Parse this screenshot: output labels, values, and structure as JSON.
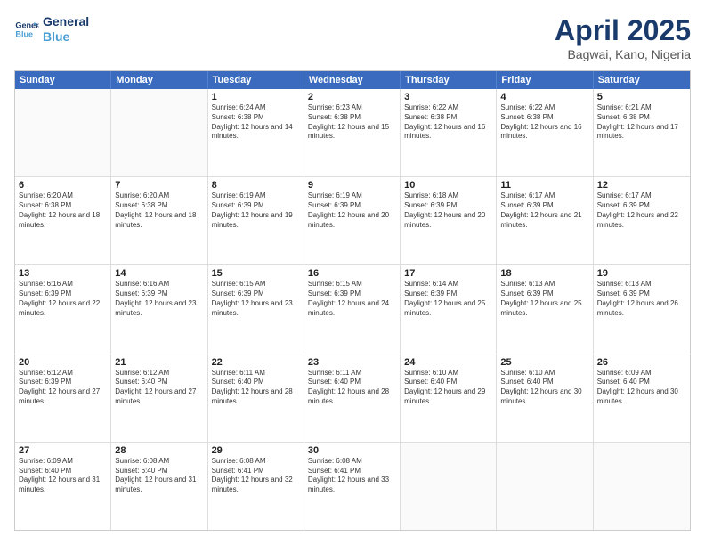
{
  "logo": {
    "line1": "General",
    "line2": "Blue"
  },
  "title": "April 2025",
  "subtitle": "Bagwai, Kano, Nigeria",
  "weekdays": [
    "Sunday",
    "Monday",
    "Tuesday",
    "Wednesday",
    "Thursday",
    "Friday",
    "Saturday"
  ],
  "weeks": [
    [
      {
        "day": "",
        "sunrise": "",
        "sunset": "",
        "daylight": ""
      },
      {
        "day": "",
        "sunrise": "",
        "sunset": "",
        "daylight": ""
      },
      {
        "day": "1",
        "sunrise": "Sunrise: 6:24 AM",
        "sunset": "Sunset: 6:38 PM",
        "daylight": "Daylight: 12 hours and 14 minutes."
      },
      {
        "day": "2",
        "sunrise": "Sunrise: 6:23 AM",
        "sunset": "Sunset: 6:38 PM",
        "daylight": "Daylight: 12 hours and 15 minutes."
      },
      {
        "day": "3",
        "sunrise": "Sunrise: 6:22 AM",
        "sunset": "Sunset: 6:38 PM",
        "daylight": "Daylight: 12 hours and 16 minutes."
      },
      {
        "day": "4",
        "sunrise": "Sunrise: 6:22 AM",
        "sunset": "Sunset: 6:38 PM",
        "daylight": "Daylight: 12 hours and 16 minutes."
      },
      {
        "day": "5",
        "sunrise": "Sunrise: 6:21 AM",
        "sunset": "Sunset: 6:38 PM",
        "daylight": "Daylight: 12 hours and 17 minutes."
      }
    ],
    [
      {
        "day": "6",
        "sunrise": "Sunrise: 6:20 AM",
        "sunset": "Sunset: 6:38 PM",
        "daylight": "Daylight: 12 hours and 18 minutes."
      },
      {
        "day": "7",
        "sunrise": "Sunrise: 6:20 AM",
        "sunset": "Sunset: 6:38 PM",
        "daylight": "Daylight: 12 hours and 18 minutes."
      },
      {
        "day": "8",
        "sunrise": "Sunrise: 6:19 AM",
        "sunset": "Sunset: 6:39 PM",
        "daylight": "Daylight: 12 hours and 19 minutes."
      },
      {
        "day": "9",
        "sunrise": "Sunrise: 6:19 AM",
        "sunset": "Sunset: 6:39 PM",
        "daylight": "Daylight: 12 hours and 20 minutes."
      },
      {
        "day": "10",
        "sunrise": "Sunrise: 6:18 AM",
        "sunset": "Sunset: 6:39 PM",
        "daylight": "Daylight: 12 hours and 20 minutes."
      },
      {
        "day": "11",
        "sunrise": "Sunrise: 6:17 AM",
        "sunset": "Sunset: 6:39 PM",
        "daylight": "Daylight: 12 hours and 21 minutes."
      },
      {
        "day": "12",
        "sunrise": "Sunrise: 6:17 AM",
        "sunset": "Sunset: 6:39 PM",
        "daylight": "Daylight: 12 hours and 22 minutes."
      }
    ],
    [
      {
        "day": "13",
        "sunrise": "Sunrise: 6:16 AM",
        "sunset": "Sunset: 6:39 PM",
        "daylight": "Daylight: 12 hours and 22 minutes."
      },
      {
        "day": "14",
        "sunrise": "Sunrise: 6:16 AM",
        "sunset": "Sunset: 6:39 PM",
        "daylight": "Daylight: 12 hours and 23 minutes."
      },
      {
        "day": "15",
        "sunrise": "Sunrise: 6:15 AM",
        "sunset": "Sunset: 6:39 PM",
        "daylight": "Daylight: 12 hours and 23 minutes."
      },
      {
        "day": "16",
        "sunrise": "Sunrise: 6:15 AM",
        "sunset": "Sunset: 6:39 PM",
        "daylight": "Daylight: 12 hours and 24 minutes."
      },
      {
        "day": "17",
        "sunrise": "Sunrise: 6:14 AM",
        "sunset": "Sunset: 6:39 PM",
        "daylight": "Daylight: 12 hours and 25 minutes."
      },
      {
        "day": "18",
        "sunrise": "Sunrise: 6:13 AM",
        "sunset": "Sunset: 6:39 PM",
        "daylight": "Daylight: 12 hours and 25 minutes."
      },
      {
        "day": "19",
        "sunrise": "Sunrise: 6:13 AM",
        "sunset": "Sunset: 6:39 PM",
        "daylight": "Daylight: 12 hours and 26 minutes."
      }
    ],
    [
      {
        "day": "20",
        "sunrise": "Sunrise: 6:12 AM",
        "sunset": "Sunset: 6:39 PM",
        "daylight": "Daylight: 12 hours and 27 minutes."
      },
      {
        "day": "21",
        "sunrise": "Sunrise: 6:12 AM",
        "sunset": "Sunset: 6:40 PM",
        "daylight": "Daylight: 12 hours and 27 minutes."
      },
      {
        "day": "22",
        "sunrise": "Sunrise: 6:11 AM",
        "sunset": "Sunset: 6:40 PM",
        "daylight": "Daylight: 12 hours and 28 minutes."
      },
      {
        "day": "23",
        "sunrise": "Sunrise: 6:11 AM",
        "sunset": "Sunset: 6:40 PM",
        "daylight": "Daylight: 12 hours and 28 minutes."
      },
      {
        "day": "24",
        "sunrise": "Sunrise: 6:10 AM",
        "sunset": "Sunset: 6:40 PM",
        "daylight": "Daylight: 12 hours and 29 minutes."
      },
      {
        "day": "25",
        "sunrise": "Sunrise: 6:10 AM",
        "sunset": "Sunset: 6:40 PM",
        "daylight": "Daylight: 12 hours and 30 minutes."
      },
      {
        "day": "26",
        "sunrise": "Sunrise: 6:09 AM",
        "sunset": "Sunset: 6:40 PM",
        "daylight": "Daylight: 12 hours and 30 minutes."
      }
    ],
    [
      {
        "day": "27",
        "sunrise": "Sunrise: 6:09 AM",
        "sunset": "Sunset: 6:40 PM",
        "daylight": "Daylight: 12 hours and 31 minutes."
      },
      {
        "day": "28",
        "sunrise": "Sunrise: 6:08 AM",
        "sunset": "Sunset: 6:40 PM",
        "daylight": "Daylight: 12 hours and 31 minutes."
      },
      {
        "day": "29",
        "sunrise": "Sunrise: 6:08 AM",
        "sunset": "Sunset: 6:41 PM",
        "daylight": "Daylight: 12 hours and 32 minutes."
      },
      {
        "day": "30",
        "sunrise": "Sunrise: 6:08 AM",
        "sunset": "Sunset: 6:41 PM",
        "daylight": "Daylight: 12 hours and 33 minutes."
      },
      {
        "day": "",
        "sunrise": "",
        "sunset": "",
        "daylight": ""
      },
      {
        "day": "",
        "sunrise": "",
        "sunset": "",
        "daylight": ""
      },
      {
        "day": "",
        "sunrise": "",
        "sunset": "",
        "daylight": ""
      }
    ]
  ]
}
